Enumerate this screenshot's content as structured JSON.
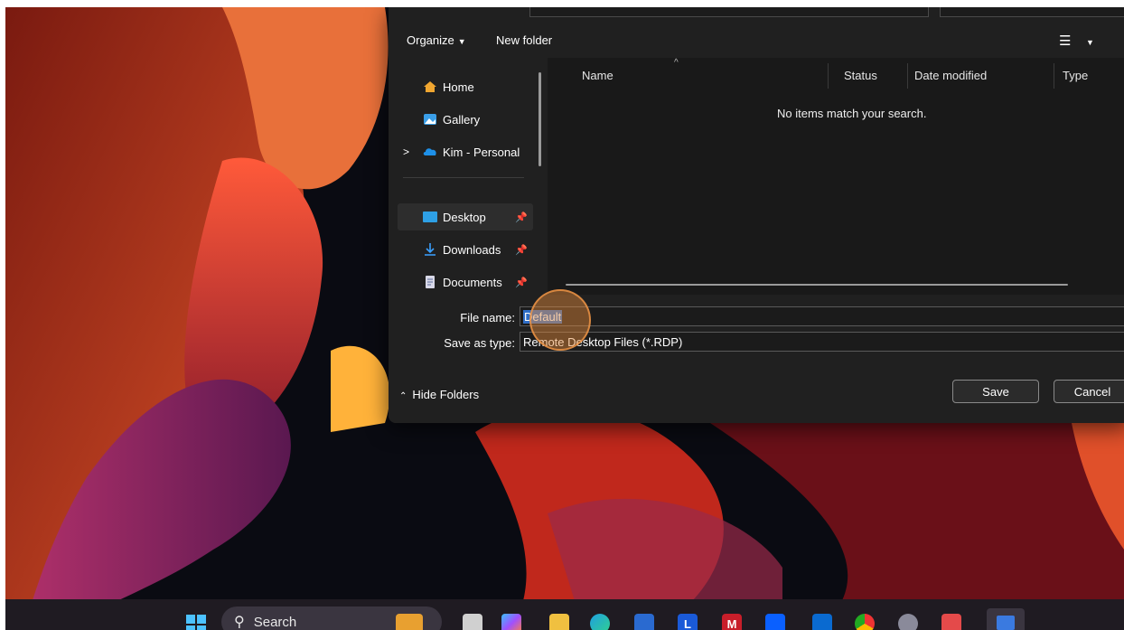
{
  "dialog": {
    "toolbar": {
      "organize_label": "Organize",
      "new_folder_label": "New folder",
      "view_icon": "list-view-icon"
    },
    "nav": {
      "items": [
        {
          "label": "Home",
          "icon": "home-icon"
        },
        {
          "label": "Gallery",
          "icon": "gallery-icon"
        },
        {
          "label": "Kim - Personal",
          "icon": "onedrive-cloud-icon",
          "expand_glyph": ">"
        },
        {
          "label": "Desktop",
          "icon": "desktop-folder-icon",
          "pinned": true,
          "selected": true
        },
        {
          "label": "Downloads",
          "icon": "download-icon",
          "pinned": true
        },
        {
          "label": "Documents",
          "icon": "documents-icon",
          "pinned": true
        }
      ],
      "pin_glyph": "📌"
    },
    "columns": [
      "Name",
      "Status",
      "Date modified",
      "Type"
    ],
    "empty_message": "No items match your search.",
    "file_name": {
      "label": "File name:",
      "value": "Default"
    },
    "save_as_type": {
      "label": "Save as type:",
      "value": "Remote Desktop Files (*.RDP)"
    },
    "hide_folders_label": "Hide Folders",
    "save_label": "Save",
    "cancel_label": "Cancel"
  },
  "taskbar": {
    "search_placeholder": "Search",
    "icons": [
      "start-icon",
      "widgets-icon",
      "task-view-icon",
      "copilot-icon",
      "file-explorer-icon",
      "edge-icon",
      "store-icon",
      "l-app-icon",
      "mcafee-icon",
      "dropbox-icon",
      "outlook-icon",
      "chrome-icon",
      "settings-icon",
      "todoist-icon",
      "remote-desktop-icon"
    ]
  },
  "colors": {
    "dialog_bg": "#202020",
    "selection": "#2f6ec7",
    "click_highlight": "#e68c3c"
  }
}
